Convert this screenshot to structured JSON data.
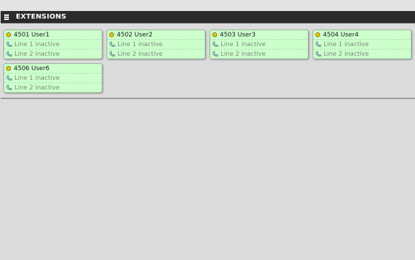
{
  "panel": {
    "title": "EXTENSIONS",
    "menu_icon": "hamburger-menu-icon"
  },
  "extensions": [
    {
      "title": "4501 User1",
      "status_color": "#e6c800",
      "lines": [
        "Line 1 inactive",
        "Line 2 inactive"
      ]
    },
    {
      "title": "4502 User2",
      "status_color": "#e6c800",
      "lines": [
        "Line 1 inactive",
        "Line 2 inactive"
      ]
    },
    {
      "title": "4503 User3",
      "status_color": "#e6c800",
      "lines": [
        "Line 1 inactive",
        "Line 2 inactive"
      ]
    },
    {
      "title": "4504 User4",
      "status_color": "#e6c800",
      "lines": [
        "Line 1 inactive",
        "Line 2 inactive"
      ]
    },
    {
      "title": "4506 User6",
      "status_color": "#e6c800",
      "lines": [
        "Line 1 inactive",
        "Line 2 inactive"
      ]
    }
  ],
  "colors": {
    "header_bg": "#2b2b2b",
    "card_bg": "#ccffcc",
    "page_bg": "#dcdcdc"
  }
}
